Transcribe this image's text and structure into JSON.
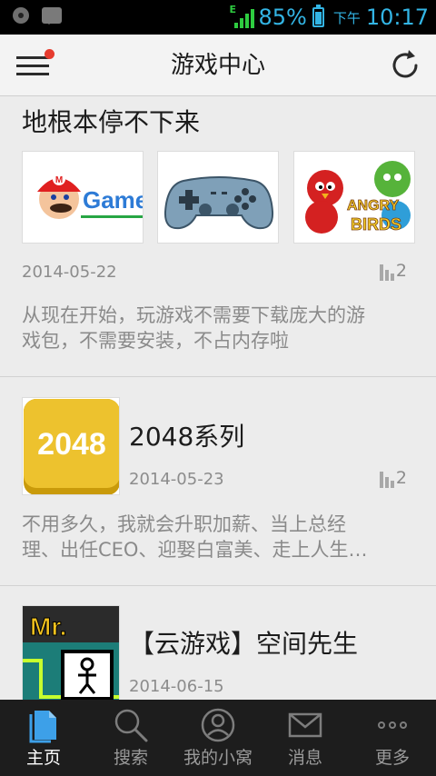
{
  "status_bar": {
    "network_type": "E",
    "battery_percent": "85%",
    "ampm": "下午",
    "time": "10:17"
  },
  "header": {
    "title": "游戏中心"
  },
  "articles": [
    {
      "title": "地根本停不下来",
      "date": "2014-05-22",
      "views": "2",
      "description_lines": [
        "从现在开始，玩游戏不需要下载庞大的游",
        "戏包，不需要安装，不占内存啦"
      ],
      "thumb_text": "Game"
    },
    {
      "title": "2048系列",
      "icon_text": "2048",
      "date": "2014-05-23",
      "views": "2",
      "description_lines": [
        "不用多久，我就会升职加薪、当上总经",
        "理、出任CEO、迎娶白富美、走上人生…"
      ]
    },
    {
      "title": "【云游戏】空间先生",
      "icon_text": "Mr.",
      "date": "2014-06-15"
    }
  ],
  "bottom_nav": [
    {
      "label": "主页",
      "icon": "document-icon",
      "active": true
    },
    {
      "label": "搜索",
      "icon": "search-icon",
      "active": false
    },
    {
      "label": "我的小窝",
      "icon": "user-icon",
      "active": false
    },
    {
      "label": "消息",
      "icon": "mail-icon",
      "active": false
    },
    {
      "label": "更多",
      "icon": "more-icon",
      "active": false
    }
  ],
  "colors": {
    "accent": "#33b5e5",
    "badge": "#e63b2e",
    "nav_active": "#3da0e8"
  }
}
